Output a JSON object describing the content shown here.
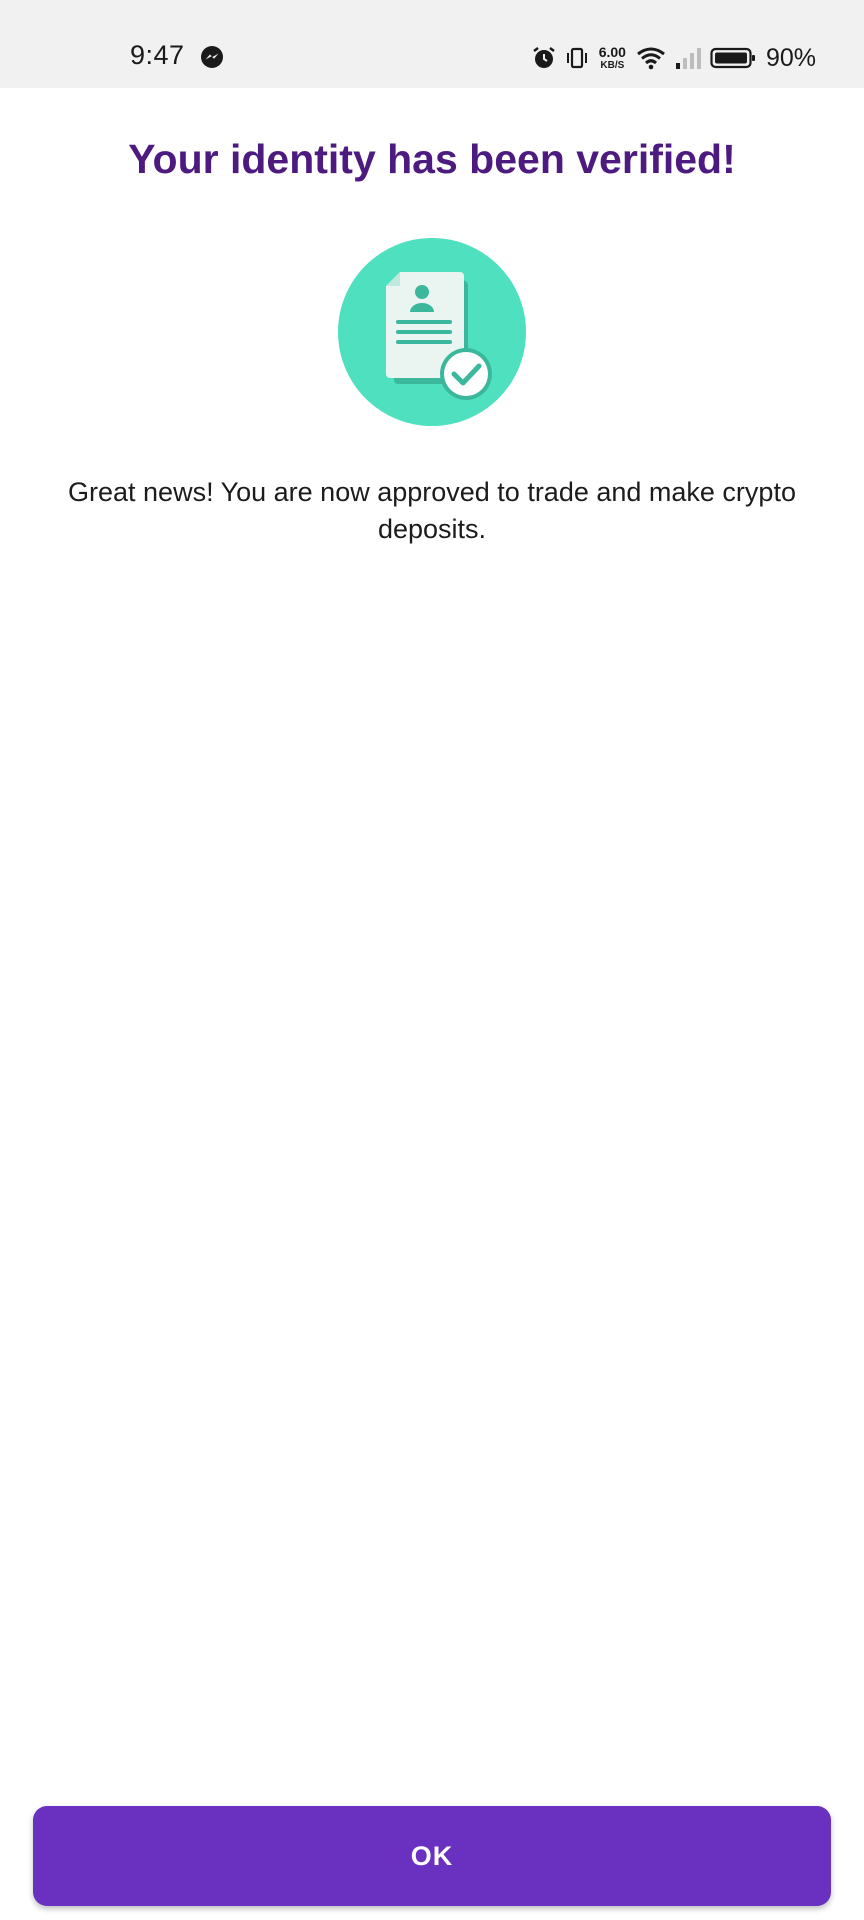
{
  "status_bar": {
    "time": "9:47",
    "network_speed_value": "6.00",
    "network_speed_unit": "KB/S",
    "battery_percent": "90%",
    "icons": [
      "messenger-icon",
      "alarm-icon",
      "vibrate-icon",
      "wifi-icon",
      "signal-icon",
      "battery-icon"
    ]
  },
  "main": {
    "title": "Your identity has been verified!",
    "illustration": "verified-document-icon",
    "message": "Great news! You are now approved to trade and make crypto deposits."
  },
  "footer": {
    "ok_label": "OK"
  },
  "colors": {
    "title": "#4d1b7f",
    "button": "#6a31c1",
    "illustration_circle": "#4fe0c0",
    "illustration_accent": "#3bb89c"
  }
}
